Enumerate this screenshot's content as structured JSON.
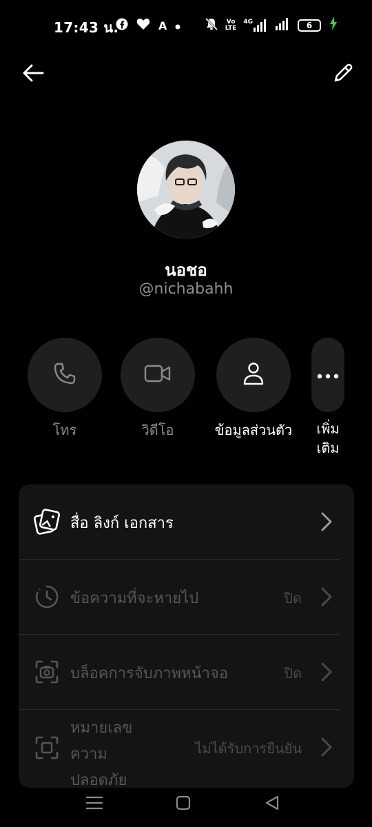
{
  "status_bar": {
    "time": "17:43 น.",
    "left_icons": [
      "facebook-icon",
      "heart-icon",
      "A",
      "dot-icon"
    ],
    "volte_line1": "Vo",
    "volte_line2": "LTE",
    "network": "4G",
    "battery": "6",
    "charging_color": "#3ccf5a"
  },
  "top_bar": {
    "back_icon": "arrow-left-icon",
    "edit_icon": "pencil-icon"
  },
  "profile": {
    "name": "นอชอ",
    "handle": "@nichabahh"
  },
  "actions": [
    {
      "icon": "phone-icon",
      "label": "โทร"
    },
    {
      "icon": "video-icon",
      "label": "วิดีโอ"
    },
    {
      "icon": "person-icon",
      "label": "ข้อมูลส่วนตัว"
    },
    {
      "icon": "more-icon",
      "label_line1": "เพิ่ม",
      "label_line2": "เติม"
    }
  ],
  "settings": [
    {
      "icon": "media-icon",
      "label": "สื่อ ลิงก์ เอกสาร",
      "value": "",
      "enabled": true
    },
    {
      "icon": "timer-icon",
      "label": "ข้อความที่จะหายไป",
      "value": "ปิด",
      "enabled": false
    },
    {
      "icon": "screenshot-icon",
      "label": "บล็อคการจับภาพหน้าจอ",
      "value": "ปิด",
      "enabled": false
    },
    {
      "icon": "scan-icon",
      "label_lines": [
        "หมายเลข",
        "ความ",
        "ปลอดภัย"
      ],
      "value": "ไม่ได้รับการยืนยัน",
      "enabled": false
    }
  ],
  "colors": {
    "background": "#000000",
    "card": "#141414",
    "button_bg": "#1f1f1f",
    "handle": "#8e8e93"
  },
  "nav_bar": [
    "menu-icon",
    "home-icon",
    "back-icon"
  ]
}
